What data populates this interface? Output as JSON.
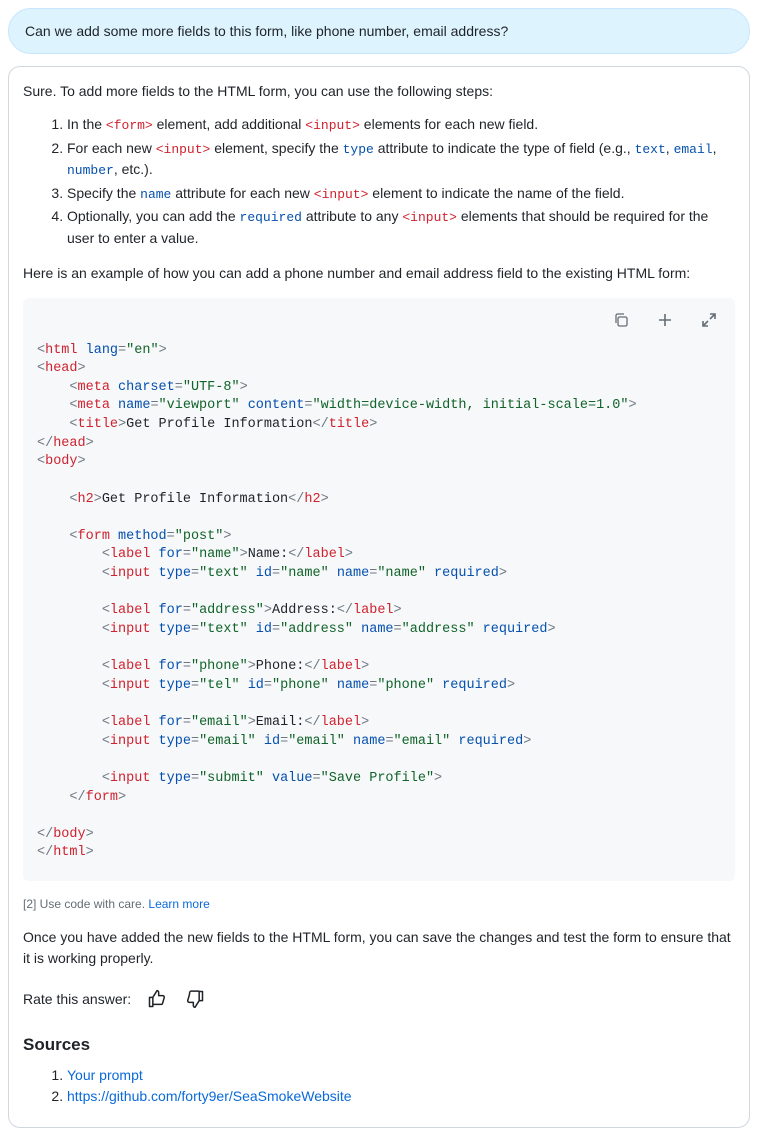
{
  "user_prompt": "Can we add some more fields to this form, like phone number, email address?",
  "answer": {
    "intro": "Sure. To add more fields to the HTML form, you can use the following steps:",
    "steps": [
      {
        "prefix": "In the ",
        "code1": "<form>",
        "mid1": " element, add additional ",
        "code2": "<input>",
        "suffix": " elements for each new field."
      },
      {
        "prefix": "For each new ",
        "code1": "<input>",
        "mid1": " element, specify the ",
        "attr1": "type",
        "mid2": " attribute to indicate the type of field (e.g., ",
        "attr2": "text",
        "mid3": ", ",
        "attr3": "email",
        "mid4": ", ",
        "attr4": "number",
        "suffix": ", etc.)."
      },
      {
        "prefix": "Specify the ",
        "attr1": "name",
        "mid1": " attribute for each new ",
        "code1": "<input>",
        "suffix": " element to indicate the name of the field."
      },
      {
        "prefix": "Optionally, you can add the ",
        "attr1": "required",
        "mid1": " attribute to any ",
        "code1": "<input>",
        "suffix": " elements that should be required for the user to enter a value."
      }
    ],
    "followup1": "Here is an example of how you can add a phone number and email address field to the existing HTML form:",
    "code": {
      "title_text": "Get Profile Information",
      "h2_text": "Get Profile Information",
      "lang": "en",
      "charset": "UTF-8",
      "viewport_name": "viewport",
      "viewport_content": "width=device-width, initial-scale=1.0",
      "form_method": "post",
      "labels": {
        "name": "Name:",
        "address": "Address:",
        "phone": "Phone:",
        "email": "Email:"
      },
      "submit_value": "Save Profile"
    },
    "disclaimer_ref": "[2]",
    "disclaimer_text": " Use code with care. ",
    "disclaimer_link": "Learn more",
    "followup2": "Once you have added the new fields to the HTML form, you can save the changes and test the form to ensure that it is working properly.",
    "rate_label": "Rate this answer:",
    "sources_heading": "Sources",
    "sources": [
      "Your prompt",
      "https://github.com/forty9er/SeaSmokeWebsite"
    ]
  }
}
